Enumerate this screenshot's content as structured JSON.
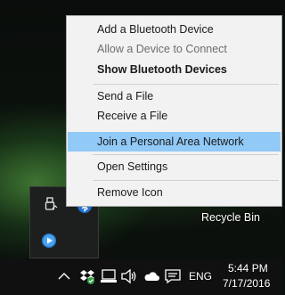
{
  "context_menu": {
    "items": [
      {
        "label": "Add a Bluetooth Device",
        "state": "normal"
      },
      {
        "label": "Allow a Device to Connect",
        "state": "disabled"
      },
      {
        "label": "Show Bluetooth Devices",
        "state": "bold"
      },
      {
        "label": "Send a File",
        "state": "normal"
      },
      {
        "label": "Receive a File",
        "state": "normal"
      },
      {
        "label": "Join a Personal Area Network",
        "state": "highlighted"
      },
      {
        "label": "Open Settings",
        "state": "normal"
      },
      {
        "label": "Remove Icon",
        "state": "normal"
      }
    ],
    "highlight_color": "#91c9f7"
  },
  "desktop": {
    "recycle_bin_label": "Recycle Bin"
  },
  "tray_flyout": {
    "icons": [
      "usb-eject-icon",
      "bluetooth-icon",
      "media-player-icon"
    ]
  },
  "taskbar": {
    "tray_icons": [
      "chevron-up-icon",
      "dropbox-icon",
      "network-icon",
      "volume-icon",
      "onedrive-icon",
      "action-center-icon"
    ],
    "language": "ENG",
    "time": "5:44 PM",
    "date": "7/17/2016"
  }
}
